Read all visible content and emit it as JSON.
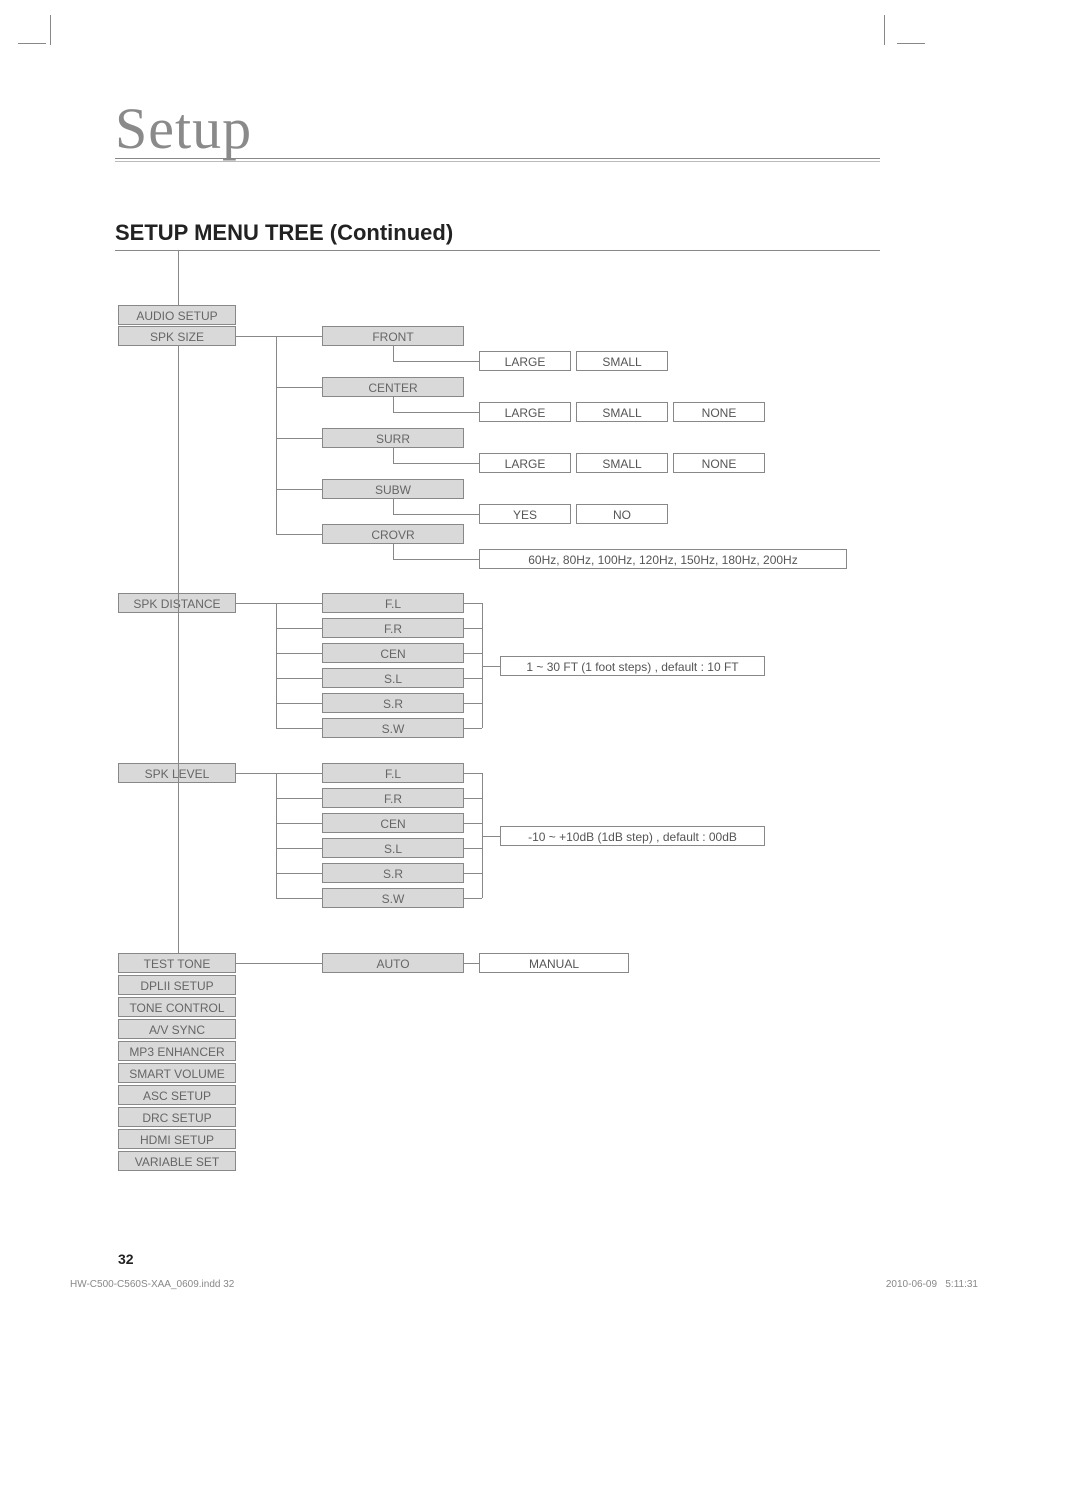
{
  "page_title": "Setup",
  "section_heading": "SETUP MENU TREE (Continued)",
  "menu": {
    "audio_setup": "AUDIO SETUP",
    "spk_size": "SPK SIZE",
    "spk_distance": "SPK DISTANCE",
    "spk_level": "SPK LEVEL",
    "test_tone": "TEST TONE",
    "dplii_setup": "DPLII SETUP",
    "tone_control": "TONE CONTROL",
    "av_sync": "A/V SYNC",
    "mp3_enhancer": "MP3 ENHANCER",
    "smart_volume": "SMART VOLUME",
    "asc_setup": "ASC SETUP",
    "drc_setup": "DRC SETUP",
    "hdmi_setup": "HDMI SETUP",
    "variable_set": "VARIABLE SET"
  },
  "spk_size": {
    "front": "FRONT",
    "front_opts": {
      "large": "LARGE",
      "small": "SMALL"
    },
    "center": "CENTER",
    "center_opts": {
      "large": "LARGE",
      "small": "SMALL",
      "none": "NONE"
    },
    "surr": "SURR",
    "surr_opts": {
      "large": "LARGE",
      "small": "SMALL",
      "none": "NONE"
    },
    "subw": "SUBW",
    "subw_opts": {
      "yes": "YES",
      "no": "NO"
    },
    "crovr": "CROVR",
    "crovr_opts": "60Hz, 80Hz, 100Hz, 120Hz, 150Hz, 180Hz, 200Hz"
  },
  "spk_distance": {
    "fl": "F.L",
    "fr": "F.R",
    "cen": "CEN",
    "sl": "S.L",
    "sr": "S.R",
    "sw": "S.W",
    "range": "1 ~ 30 FT (1 foot steps) , default : 10 FT"
  },
  "spk_level": {
    "fl": "F.L",
    "fr": "F.R",
    "cen": "CEN",
    "sl": "S.L",
    "sr": "S.R",
    "sw": "S.W",
    "range": "-10 ~ +10dB (1dB step) , default : 00dB"
  },
  "test_tone": {
    "auto": "AUTO",
    "manual": "MANUAL"
  },
  "page_number": "32",
  "footer_file": "HW-C500-C560S-XAA_0609.indd   32",
  "footer_date": "2010-06-09",
  "footer_time": "5:11:31"
}
